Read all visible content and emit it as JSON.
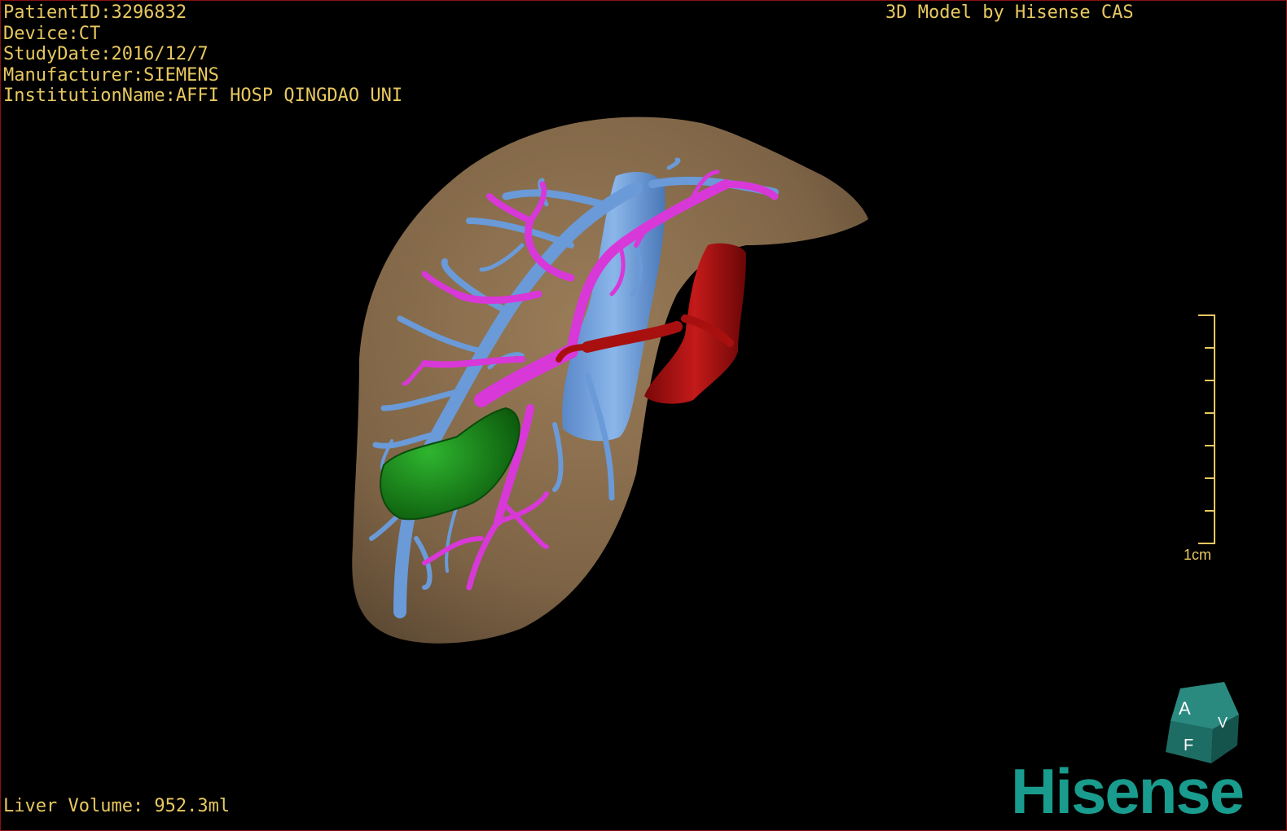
{
  "patient": {
    "id_line": "PatientID:3296832",
    "device_line": "Device:CT",
    "study_date_line": "StudyDate:2016/12/7",
    "manufacturer_line": "Manufacturer:SIEMENS",
    "institution_line": "InstitutionName:AFFI HOSP QINGDAO UNI"
  },
  "header": {
    "brand_caption": "3D Model by Hisense CAS"
  },
  "footer": {
    "volume_line": "Liver Volume: 952.3ml"
  },
  "scale_bar": {
    "label": "1cm"
  },
  "orientation_cube": {
    "labels": [
      "A",
      "F",
      "V"
    ]
  },
  "logo": {
    "text": "Hisense"
  },
  "colors": {
    "overlay_text": "#e8c860",
    "liver": "#8a6e4e",
    "portal_vein": "#d838d8",
    "hepatic_vein": "#6a9ad8",
    "artery": "#a81010",
    "tumor": "#1a8a1a",
    "brand": "#199b8d"
  }
}
